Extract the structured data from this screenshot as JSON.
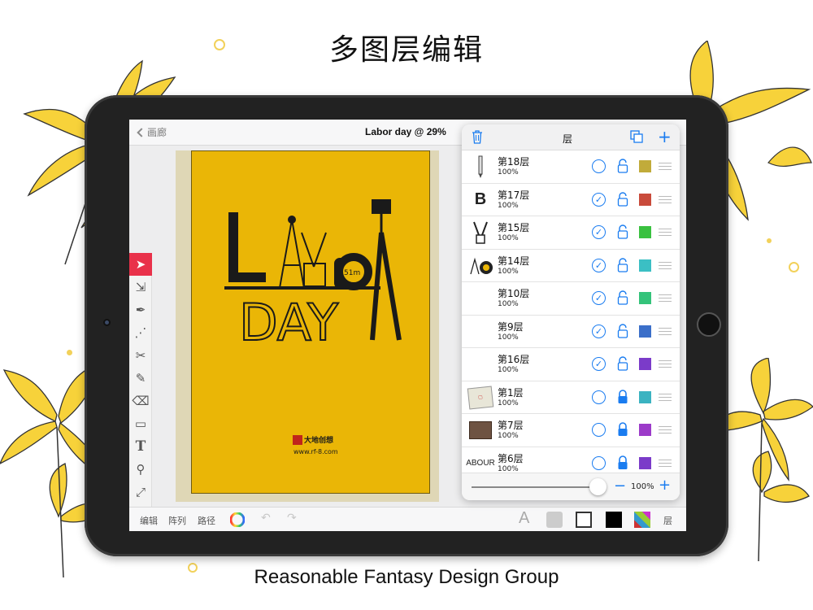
{
  "headline": "多图层编辑",
  "footer": "Reasonable Fantasy Design Group",
  "app": {
    "back_label": "画廊",
    "document_title": "Labor day @ 29%",
    "artwork": {
      "title_line1_left": "LAB",
      "title_line1_right": "R",
      "title_line2": "DAY",
      "tape_label": "51m",
      "brand_name": "大地创想",
      "brand_url": "www.rf-8.com",
      "background_color": "#eab606"
    },
    "tools": [
      "select-tool",
      "direct-select-tool",
      "pen-tool",
      "node-tool",
      "scissors-tool",
      "brush-tool",
      "eraser-tool",
      "shape-tool",
      "text-tool",
      "eyedropper-tool",
      "transform-tool"
    ],
    "bottom_bar": {
      "edit_label": "编辑",
      "array_label": "阵列",
      "path_label": "路径",
      "layers_label": "层"
    },
    "layers_panel": {
      "title": "层",
      "layers": [
        {
          "name": "第18层",
          "opacity": "100%",
          "visible": false,
          "locked": false,
          "color": "#c1ab3a",
          "thumb": "pencil"
        },
        {
          "name": "第17层",
          "opacity": "100%",
          "visible": true,
          "locked": false,
          "color": "#c94b3b",
          "thumb": "B"
        },
        {
          "name": "第15层",
          "opacity": "100%",
          "visible": true,
          "locked": false,
          "color": "#3ac140",
          "thumb": "tools"
        },
        {
          "name": "第14层",
          "opacity": "100%",
          "visible": true,
          "locked": false,
          "color": "#3bbfc4",
          "thumb": "tape"
        },
        {
          "name": "第10层",
          "opacity": "100%",
          "visible": true,
          "locked": false,
          "color": "#34c37a",
          "thumb": ""
        },
        {
          "name": "第9层",
          "opacity": "100%",
          "visible": true,
          "locked": false,
          "color": "#3b6fc9",
          "thumb": ""
        },
        {
          "name": "第16层",
          "opacity": "100%",
          "visible": true,
          "locked": false,
          "color": "#7b3bc9",
          "thumb": ""
        },
        {
          "name": "第1层",
          "opacity": "100%",
          "visible": false,
          "locked": true,
          "color": "#3bb3c1",
          "thumb": "calendar"
        },
        {
          "name": "第7层",
          "opacity": "100%",
          "visible": false,
          "locked": true,
          "color": "#9c3bc9",
          "thumb": "box"
        },
        {
          "name": "第6层",
          "opacity": "100%",
          "visible": false,
          "locked": true,
          "color": "#7b3bc9",
          "thumb": "ABOUR"
        }
      ],
      "opacity_slider_value": 1.0,
      "zoom_label": "100%"
    }
  },
  "colors": {
    "accent": "#1a7cf0",
    "active_tool": "#e9314a",
    "flower_yellow": "#f7d23a"
  }
}
